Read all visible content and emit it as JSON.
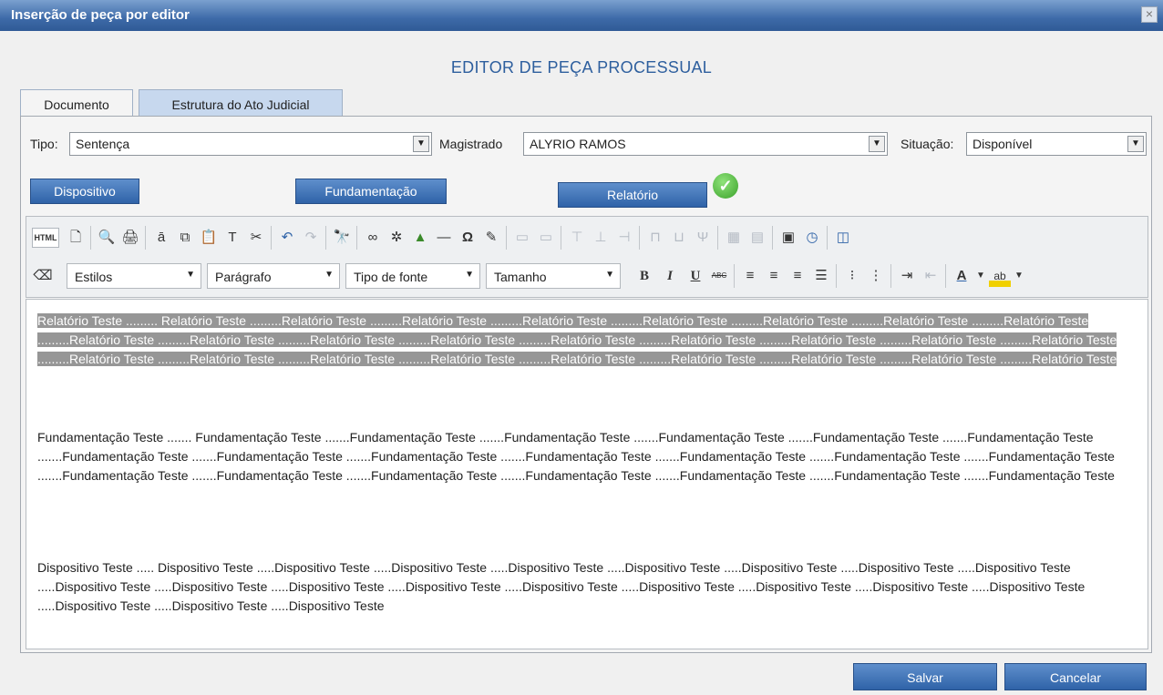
{
  "window": {
    "title": "Inserção de peça por editor",
    "close_glyph": "×"
  },
  "heading": "EDITOR DE PEÇA PROCESSUAL",
  "tabs": [
    {
      "label": "Documento",
      "active": true
    },
    {
      "label": "Estrutura do Ato Judicial",
      "active": false
    }
  ],
  "fields": {
    "tipo": {
      "label": "Tipo:",
      "value": "Sentença"
    },
    "magistrado": {
      "label": "Magistrado",
      "value": "ALYRIO RAMOS"
    },
    "situacao": {
      "label": "Situação:",
      "value": "Disponível"
    }
  },
  "sections": {
    "dispositivo": "Dispositivo",
    "fundamentacao": "Fundamentação",
    "relatorio": "Relatório"
  },
  "toolbar": {
    "html_label": "HTML",
    "estilos": "Estilos",
    "paragrafo": "Parágrafo",
    "fonte": "Tipo de fonte",
    "tamanho": "Tamanho",
    "bold": "B",
    "italic": "I",
    "underline": "U",
    "strike": "ABC"
  },
  "content": {
    "relatorio": "Relatório Teste ......... Relatório Teste .........Relatório Teste .........Relatório Teste .........Relatório Teste .........Relatório Teste .........Relatório Teste .........Relatório Teste .........Relatório Teste .........Relatório Teste .........Relatório Teste .........Relatório Teste .........Relatório Teste .........Relatório Teste .........Relatório Teste .........Relatório Teste .........Relatório Teste .........Relatório Teste .........Relatório Teste .........Relatório Teste .........Relatório Teste .........Relatório Teste .........Relatório Teste .........Relatório Teste .........Relatório Teste .........Relatório Teste .........Relatório Teste",
    "fundamentacao": "Fundamentação Teste ....... Fundamentação Teste .......Fundamentação Teste .......Fundamentação Teste .......Fundamentação Teste .......Fundamentação Teste .......Fundamentação Teste .......Fundamentação Teste .......Fundamentação Teste .......Fundamentação Teste .......Fundamentação Teste .......Fundamentação Teste .......Fundamentação Teste .......Fundamentação Teste .......Fundamentação Teste .......Fundamentação Teste .......Fundamentação Teste .......Fundamentação Teste .......Fundamentação Teste .......Fundamentação Teste .......Fundamentação Teste",
    "dispositivo": "Dispositivo Teste ..... Dispositivo Teste .....Dispositivo Teste .....Dispositivo Teste .....Dispositivo Teste .....Dispositivo Teste .....Dispositivo Teste .....Dispositivo Teste .....Dispositivo Teste .....Dispositivo Teste .....Dispositivo Teste .....Dispositivo Teste .....Dispositivo Teste .....Dispositivo Teste .....Dispositivo Teste .....Dispositivo Teste .....Dispositivo Teste .....Dispositivo Teste .....Dispositivo Teste .....Dispositivo Teste .....Dispositivo Teste"
  },
  "buttons": {
    "save": "Salvar",
    "cancel": "Cancelar"
  }
}
